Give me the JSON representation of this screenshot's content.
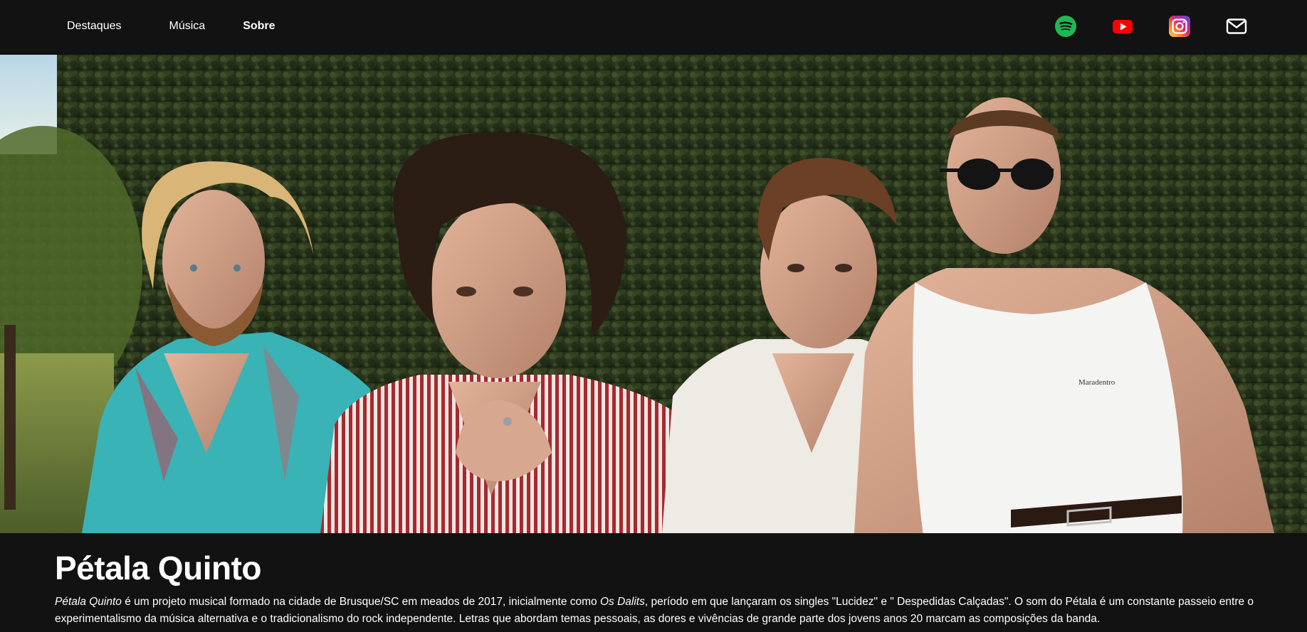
{
  "nav": {
    "links": [
      {
        "label": "Destaques",
        "active": false
      },
      {
        "label": "Música",
        "active": false
      },
      {
        "label": "Sobre",
        "active": true
      }
    ],
    "icons": [
      {
        "name": "spotify-icon",
        "color": "#1db954"
      },
      {
        "name": "youtube-icon",
        "color": "#ff0000"
      },
      {
        "name": "instagram-icon",
        "color": "#c13584"
      },
      {
        "name": "mail-icon",
        "color": "#ffffff"
      }
    ]
  },
  "hero": {
    "photo": "band-photo",
    "shirt_text": "Maradentro"
  },
  "about": {
    "title": "Pétala Quinto",
    "desc": {
      "p1_italic": "Pétala Quinto",
      "p2": " é um projeto musical formado na cidade de Brusque/SC em meados de 2017, inicialmente como ",
      "p3_italic": "Os Dalits",
      "p4": ", período em que lançaram os singles \"Lucidez\" e \" Despedidas Calçadas\". O som do Pétala é um constante passeio entre o experimentalismo da música alternativa e o tradicionalismo do rock independente. Letras que abordam temas pessoais, as dores e vivências de grande parte dos jovens anos 20 marcam as composições da banda."
    }
  }
}
